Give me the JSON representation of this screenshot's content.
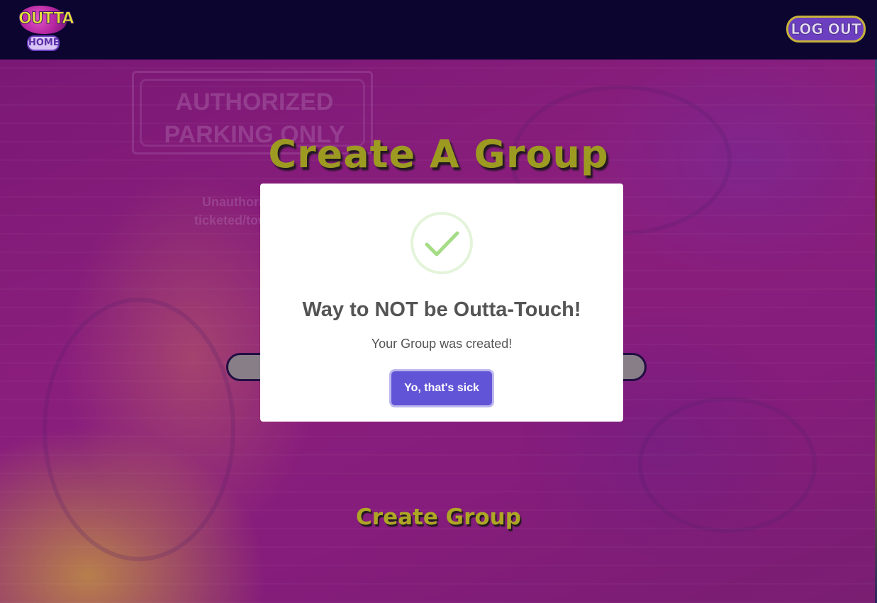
{
  "nav": {
    "logo_top": "OUTTA",
    "logo_bottom": "HOME",
    "logout_label": "LOG OUT"
  },
  "background": {
    "sign_line1": "AUTHORIZED",
    "sign_line2": "PARKING ONLY",
    "sign_sub_line1": "Unauthorized ve",
    "sign_sub_line2": "ticketed/towed at o"
  },
  "page": {
    "title": "Create A Group",
    "submit_label": "Create Group"
  },
  "modal": {
    "icon": "check-icon",
    "title": "Way to NOT be Outta-Touch!",
    "message": "Your Group was created!",
    "confirm_label": "Yo, that's sick"
  },
  "colors": {
    "nav_bg": "#0b0530",
    "page_bg": "#a2208c",
    "title_yellow": "#b9c01b",
    "confirm_button": "#6254d6",
    "check_green": "#a5dc86"
  }
}
